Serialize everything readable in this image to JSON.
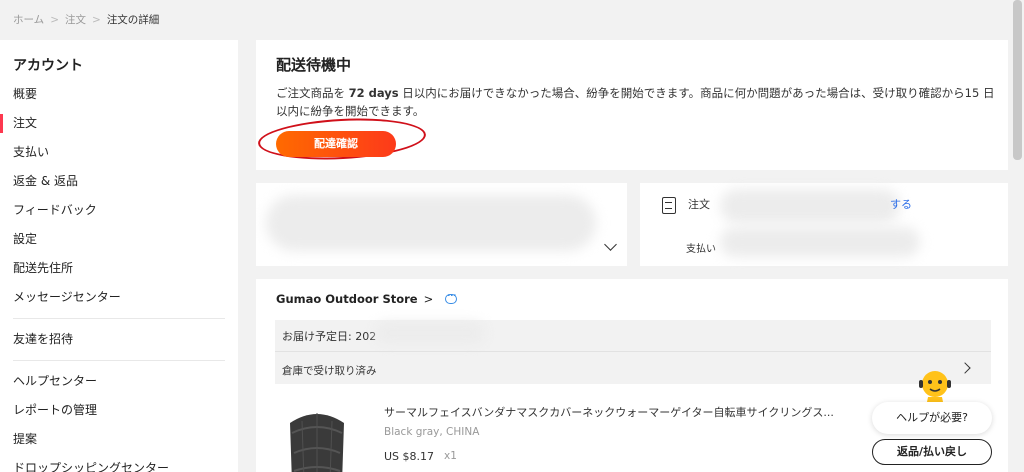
{
  "breadcrumb": {
    "home": "ホーム",
    "orders": "注文",
    "current": "注文の詳細",
    "sep": ">"
  },
  "sidebar": {
    "heading": "アカウント",
    "items": [
      {
        "label": "概要"
      },
      {
        "label": "注文",
        "active": true
      },
      {
        "label": "支払い"
      },
      {
        "label": "返金 & 返品"
      },
      {
        "label": "フィードバック"
      },
      {
        "label": "設定"
      },
      {
        "label": "配送先住所"
      },
      {
        "label": "メッセージセンター"
      }
    ],
    "items2": [
      {
        "label": "友達を招待"
      }
    ],
    "items3": [
      {
        "label": "ヘルプセンター"
      },
      {
        "label": "レポートの管理"
      },
      {
        "label": "提案"
      },
      {
        "label": "ドロップシッピングセンター"
      }
    ]
  },
  "status": {
    "title": "配送待機中",
    "text_pre": "ご注文商品を ",
    "days": "72 days",
    "text_post": " 日以内にお届けできなかった場合、紛争を開始できます。商品に何か問題があった場合は、受け取り確認から15 日以内に紛争を開始できます。",
    "confirm_button": "配達確認"
  },
  "payment_card": {
    "label1": "注文",
    "link": "する",
    "label2": "支払い"
  },
  "store": {
    "name": "Gumao Outdoor Store",
    "arrow": ">",
    "delivery_date": "お届け予定日: 202",
    "warehouse_status": "倉庫で受け取り済み"
  },
  "product": {
    "title": "サーマルフェイスバンダナマスクカバーネックウォーマーゲイター自転車サイクリングス...",
    "variant": "Black gray, CHINA",
    "price": "US $8.17",
    "qty": "x1"
  },
  "help": {
    "bubble": "ヘルプが必要?",
    "return_button": "返品/払い戻し"
  },
  "colors": {
    "accent": "#fd384f",
    "button_gradient_start": "#ff6a00",
    "button_gradient_end": "#fd3a1a",
    "link": "#2b6de8",
    "annotation_circle": "#d0101a"
  }
}
